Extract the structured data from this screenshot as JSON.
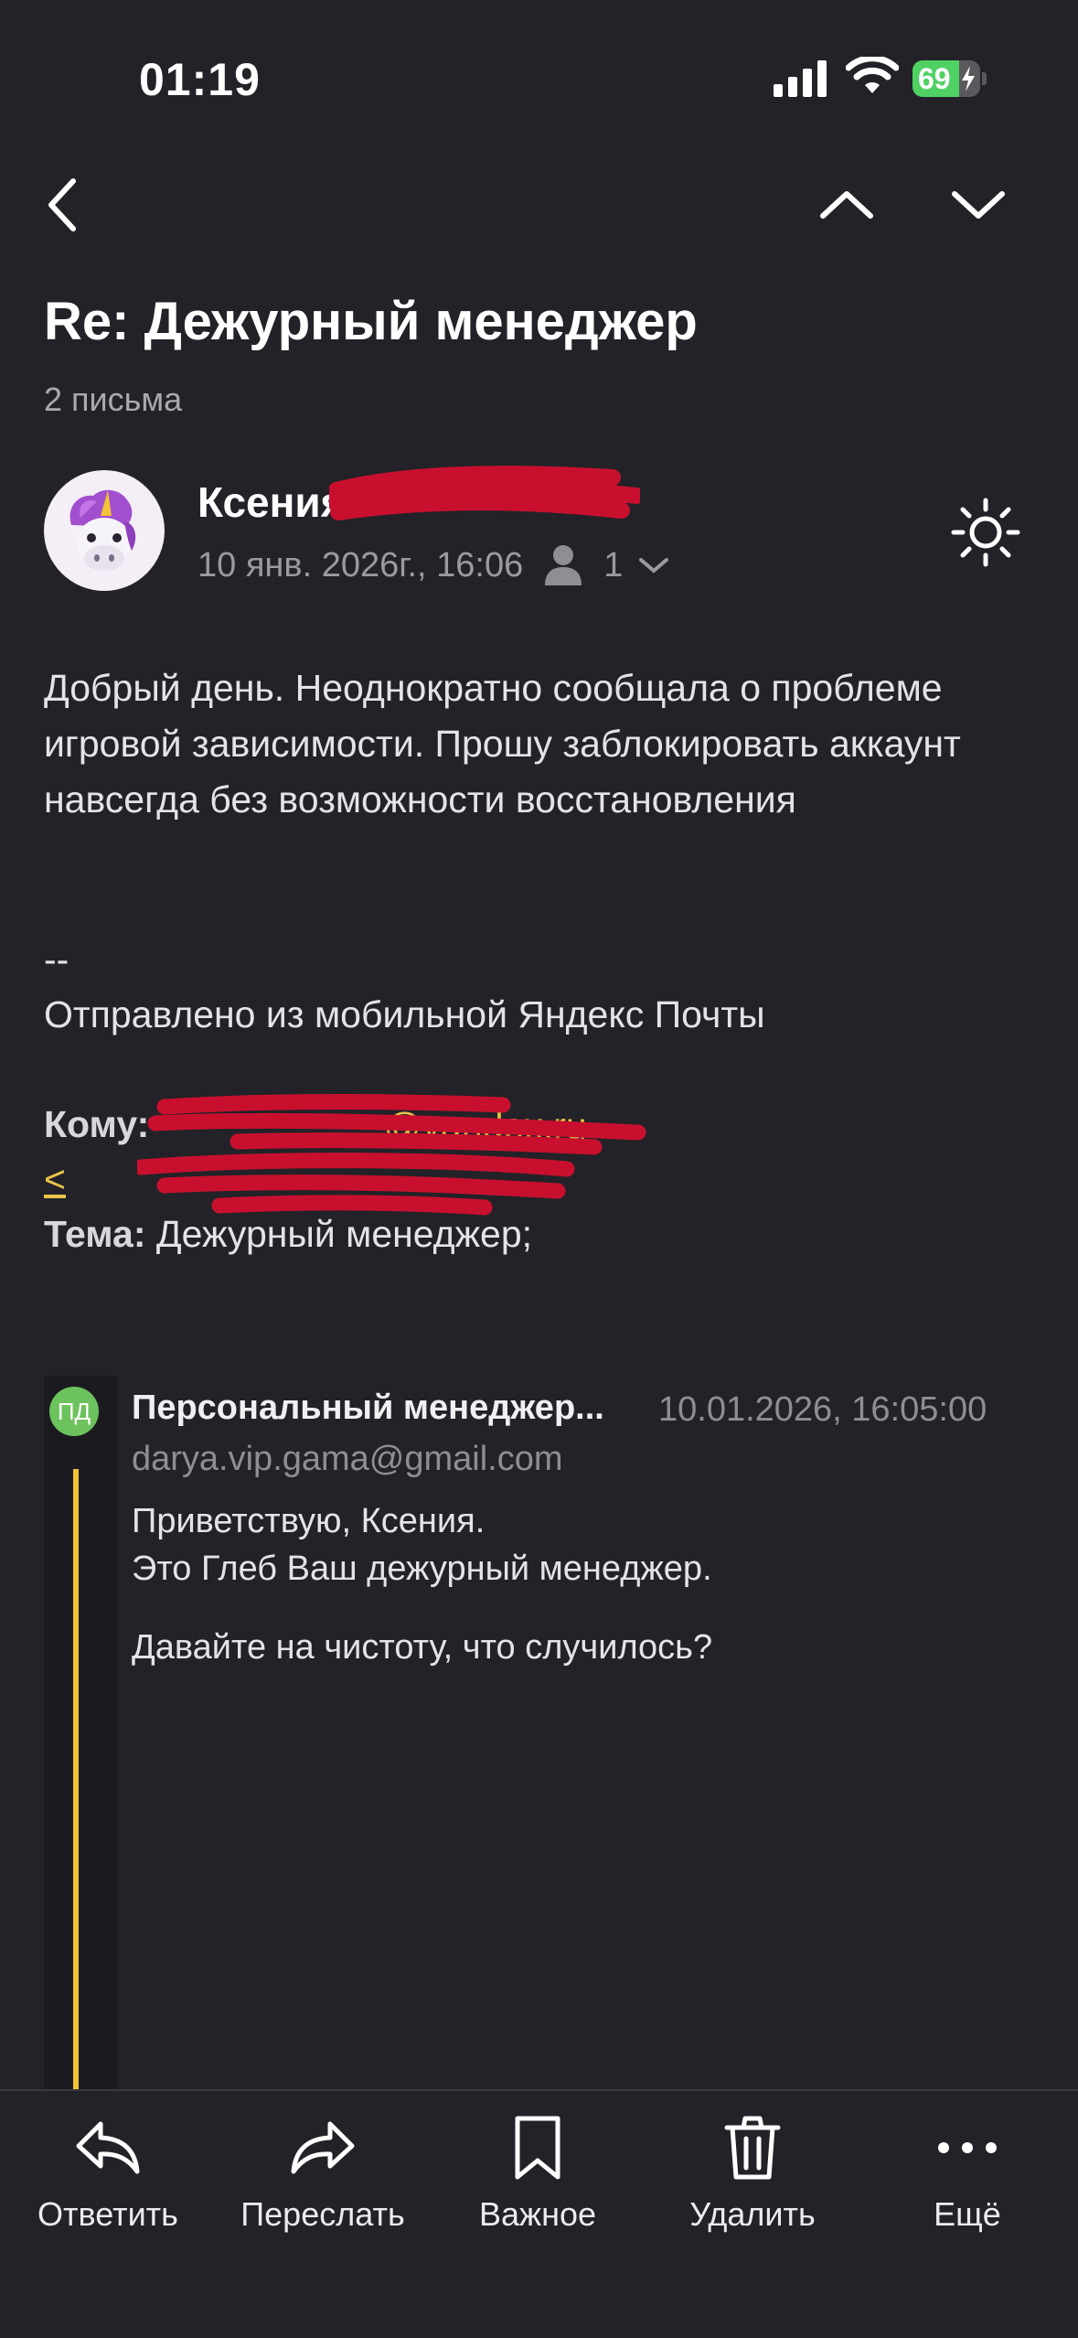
{
  "status_bar": {
    "time": "01:19",
    "battery": "69",
    "battery_level": 0.69
  },
  "nav": {
    "back_icon": "chevron-left-icon",
    "prev_icon": "chevron-up-icon",
    "next_icon": "chevron-down-icon"
  },
  "thread": {
    "subject": "Re: Дежурный менеджер",
    "count": "2 письма"
  },
  "message": {
    "sender": "Ксения",
    "date": "10 янв. 2026г., 16:06",
    "recipients_count": "1",
    "body": "Добрый день. Неоднократно сообщала о проблеме игровой зависимости. Прошу заблокировать аккаунт навсегда без возможности восстановления",
    "signature_dash": "--",
    "signature": "Отправлено из мобильной Яндекс Почты",
    "to_label": "Кому:",
    "to_address": "@yandex.ru",
    "to_address2": "<",
    "topic_label": "Тема:",
    "topic_value": " Дежурный менеджер;"
  },
  "quoted": {
    "avatar_initials": "ПД",
    "sender": "Персональный менеджер...",
    "date": "10.01.2026, 16:05:00",
    "email": "darya.vip.gama@gmail.com",
    "line1": "Приветствую, Ксения.",
    "line2": "Это Глеб Ваш дежурный менеджер.",
    "line3": "Давайте на чистоту, что случилось?"
  },
  "toolbar": {
    "reply": "Ответить",
    "forward": "Переслать",
    "important": "Важное",
    "delete": "Удалить",
    "more": "Ещё"
  },
  "colors": {
    "background": "#232228",
    "accent": "#f3c437",
    "link": "#e8c34a",
    "quote_avatar": "#6cc25d",
    "redaction": "#c8102e"
  }
}
